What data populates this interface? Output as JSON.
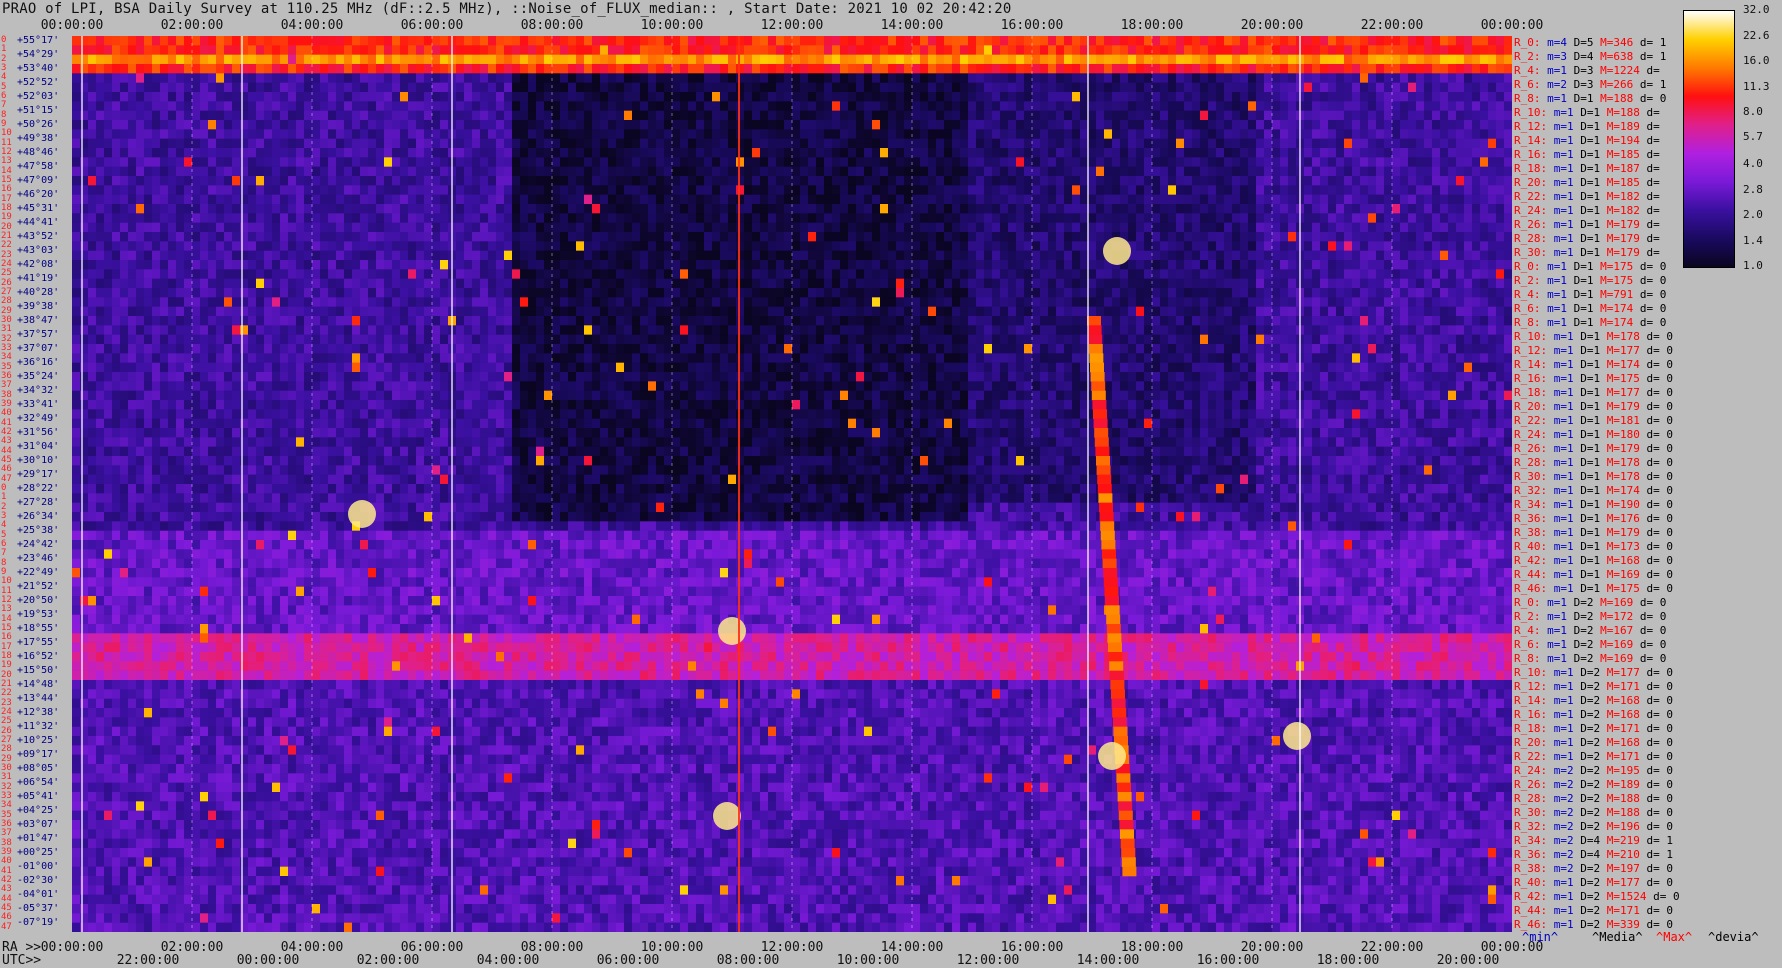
{
  "title": "PRAO of LPI, BSA Daily Survey at 110.25 MHz (dF::2.5 MHz), ::Noise_of_FLUX_median:: , Start Date: 2021 10 02 20:42:20",
  "chart_data": {
    "type": "heatmap",
    "title": "PRAO of LPI, BSA Daily Survey at 110.25 MHz (dF::2.5 MHz), ::Noise_of_FLUX_median:: , Start Date: 2021 10 02 20:42:20",
    "x_top_labels": [
      "00:00:00",
      "02:00:00",
      "04:00:00",
      "06:00:00",
      "08:00:00",
      "10:00:00",
      "12:00:00",
      "14:00:00",
      "16:00:00",
      "18:00:00",
      "20:00:00",
      "22:00:00",
      "00:00:00"
    ],
    "ra_prefix": "RA >>",
    "ra_labels": [
      "00:00:00",
      "02:00:00",
      "04:00:00",
      "06:00:00",
      "08:00:00",
      "10:00:00",
      "12:00:00",
      "14:00:00",
      "16:00:00",
      "18:00:00",
      "20:00:00",
      "22:00:00",
      "00:00:00"
    ],
    "utc_prefix": "UTC>>",
    "utc_labels": [
      "22:00:00",
      "00:00:00",
      "02:00:00",
      "04:00:00",
      "06:00:00",
      "08:00:00",
      "10:00:00",
      "12:00:00",
      "14:00:00",
      "16:00:00",
      "18:00:00",
      "20:00:00"
    ],
    "row_indices": [
      "0",
      "1",
      "2",
      "3",
      "4",
      "5",
      "6",
      "7",
      "8",
      "9",
      "10",
      "11",
      "12",
      "13",
      "14",
      "15",
      "16",
      "17",
      "18",
      "19",
      "20",
      "21",
      "22",
      "23",
      "24",
      "25",
      "26",
      "27",
      "28",
      "29",
      "30",
      "31",
      "32",
      "33",
      "34",
      "35",
      "36",
      "37",
      "38",
      "39",
      "40",
      "41",
      "42",
      "43",
      "44",
      "45",
      "46",
      "47",
      "0",
      "1",
      "2",
      "3",
      "4",
      "5",
      "6",
      "7",
      "8",
      "9",
      "10",
      "11",
      "12",
      "13",
      "14",
      "15",
      "16",
      "17",
      "18",
      "19",
      "20",
      "21",
      "22",
      "23",
      "24",
      "25",
      "26",
      "27",
      "28",
      "29",
      "30",
      "31",
      "32",
      "33",
      "34",
      "35",
      "36",
      "37",
      "38",
      "39",
      "40",
      "41",
      "42",
      "43",
      "44",
      "45",
      "46",
      "47"
    ],
    "declinations": [
      "+55°17'",
      "+54°29'",
      "+53°40'",
      "+52°52'",
      "+52°03'",
      "+51°15'",
      "+50°26'",
      "+49°38'",
      "+48°46'",
      "+47°58'",
      "+47°09'",
      "+46°20'",
      "+45°31'",
      "+44°41'",
      "+43°52'",
      "+43°03'",
      "+42°08'",
      "+41°19'",
      "+40°28'",
      "+39°38'",
      "+38°47'",
      "+37°57'",
      "+37°07'",
      "+36°16'",
      "+35°24'",
      "+34°32'",
      "+33°41'",
      "+32°49'",
      "+31°56'",
      "+31°04'",
      "+30°10'",
      "+29°17'",
      "+28°22'",
      "+27°28'",
      "+26°34'",
      "+25°38'",
      "+24°42'",
      "+23°46'",
      "+22°49'",
      "+21°52'",
      "+20°50'",
      "+19°53'",
      "+18°55'",
      "+17°55'",
      "+16°52'",
      "+15°50'",
      "+14°48'",
      "+13°44'",
      "+12°38'",
      "+11°32'",
      "+10°25'",
      "+09°17'",
      "+08°05'",
      "+06°54'",
      "+05°41'",
      "+04°25'",
      "+03°07'",
      "+01°47'",
      "+00°25'",
      "-01°00'",
      "-02°30'",
      "-04°01'",
      "-05°37'",
      "-07°19'"
    ],
    "row_stats": [
      [
        "R_0:",
        "m=4",
        "D=5",
        "M=346",
        "d= 1"
      ],
      [
        "R_2:",
        "m=3",
        "D=4",
        "M=638",
        "d= 1"
      ],
      [
        "R_4:",
        "m=1",
        "D=3",
        "M=1224",
        "d="
      ],
      [
        "R_6:",
        "m=2",
        "D=3",
        "M=266",
        "d= 1"
      ],
      [
        "R_8:",
        "m=1",
        "D=1",
        "M=188",
        "d= 0"
      ],
      [
        "R_10:",
        "m=1",
        "D=1",
        "M=188",
        "d="
      ],
      [
        "R_12:",
        "m=1",
        "D=1",
        "M=189",
        "d="
      ],
      [
        "R_14:",
        "m=1",
        "D=1",
        "M=194",
        "d="
      ],
      [
        "R_16:",
        "m=1",
        "D=1",
        "M=185",
        "d="
      ],
      [
        "R_18:",
        "m=1",
        "D=1",
        "M=187",
        "d="
      ],
      [
        "R_20:",
        "m=1",
        "D=1",
        "M=185",
        "d="
      ],
      [
        "R_22:",
        "m=1",
        "D=1",
        "M=182",
        "d="
      ],
      [
        "R_24:",
        "m=1",
        "D=1",
        "M=182",
        "d="
      ],
      [
        "R_26:",
        "m=1",
        "D=1",
        "M=179",
        "d="
      ],
      [
        "R_28:",
        "m=1",
        "D=1",
        "M=179",
        "d="
      ],
      [
        "R_30:",
        "m=1",
        "D=1",
        "M=179",
        "d="
      ],
      [
        "R_0:",
        "m=1",
        "D=1",
        "M=175",
        "d= 0"
      ],
      [
        "R_2:",
        "m=1",
        "D=1",
        "M=175",
        "d= 0"
      ],
      [
        "R_4:",
        "m=1",
        "D=1",
        "M=791",
        "d= 0"
      ],
      [
        "R_6:",
        "m=1",
        "D=1",
        "M=174",
        "d= 0"
      ],
      [
        "R_8:",
        "m=1",
        "D=1",
        "M=174",
        "d= 0"
      ],
      [
        "R_10:",
        "m=1",
        "D=1",
        "M=178",
        "d= 0"
      ],
      [
        "R_12:",
        "m=1",
        "D=1",
        "M=177",
        "d= 0"
      ],
      [
        "R_14:",
        "m=1",
        "D=1",
        "M=174",
        "d= 0"
      ],
      [
        "R_16:",
        "m=1",
        "D=1",
        "M=175",
        "d= 0"
      ],
      [
        "R_18:",
        "m=1",
        "D=1",
        "M=177",
        "d= 0"
      ],
      [
        "R_20:",
        "m=1",
        "D=1",
        "M=179",
        "d= 0"
      ],
      [
        "R_22:",
        "m=1",
        "D=1",
        "M=181",
        "d= 0"
      ],
      [
        "R_24:",
        "m=1",
        "D=1",
        "M=180",
        "d= 0"
      ],
      [
        "R_26:",
        "m=1",
        "D=1",
        "M=179",
        "d= 0"
      ],
      [
        "R_28:",
        "m=1",
        "D=1",
        "M=178",
        "d= 0"
      ],
      [
        "R_30:",
        "m=1",
        "D=1",
        "M=178",
        "d= 0"
      ],
      [
        "R_32:",
        "m=1",
        "D=1",
        "M=174",
        "d= 0"
      ],
      [
        "R_34:",
        "m=1",
        "D=1",
        "M=190",
        "d= 0"
      ],
      [
        "R_36:",
        "m=1",
        "D=1",
        "M=176",
        "d= 0"
      ],
      [
        "R_38:",
        "m=1",
        "D=1",
        "M=179",
        "d= 0"
      ],
      [
        "R_40:",
        "m=1",
        "D=1",
        "M=173",
        "d= 0"
      ],
      [
        "R_42:",
        "m=1",
        "D=1",
        "M=168",
        "d= 0"
      ],
      [
        "R_44:",
        "m=1",
        "D=1",
        "M=169",
        "d= 0"
      ],
      [
        "R_46:",
        "m=1",
        "D=1",
        "M=175",
        "d= 0"
      ],
      [
        "R_0:",
        "m=1",
        "D=2",
        "M=169",
        "d= 0"
      ],
      [
        "R_2:",
        "m=1",
        "D=2",
        "M=172",
        "d= 0"
      ],
      [
        "R_4:",
        "m=1",
        "D=2",
        "M=167",
        "d= 0"
      ],
      [
        "R_6:",
        "m=1",
        "D=2",
        "M=169",
        "d= 0"
      ],
      [
        "R_8:",
        "m=1",
        "D=2",
        "M=169",
        "d= 0"
      ],
      [
        "R_10:",
        "m=1",
        "D=2",
        "M=177",
        "d= 0"
      ],
      [
        "R_12:",
        "m=1",
        "D=2",
        "M=171",
        "d= 0"
      ],
      [
        "R_14:",
        "m=1",
        "D=2",
        "M=168",
        "d= 0"
      ],
      [
        "R_16:",
        "m=1",
        "D=2",
        "M=168",
        "d= 0"
      ],
      [
        "R_18:",
        "m=1",
        "D=2",
        "M=171",
        "d= 0"
      ],
      [
        "R_20:",
        "m=1",
        "D=2",
        "M=168",
        "d= 0"
      ],
      [
        "R_22:",
        "m=1",
        "D=2",
        "M=171",
        "d= 0"
      ],
      [
        "R_24:",
        "m=2",
        "D=2",
        "M=195",
        "d= 0"
      ],
      [
        "R_26:",
        "m=2",
        "D=2",
        "M=189",
        "d= 0"
      ],
      [
        "R_28:",
        "m=2",
        "D=2",
        "M=188",
        "d= 0"
      ],
      [
        "R_30:",
        "m=2",
        "D=2",
        "M=188",
        "d= 0"
      ],
      [
        "R_32:",
        "m=2",
        "D=2",
        "M=196",
        "d= 0"
      ],
      [
        "R_34:",
        "m=2",
        "D=4",
        "M=219",
        "d= 1"
      ],
      [
        "R_36:",
        "m=2",
        "D=4",
        "M=210",
        "d= 1"
      ],
      [
        "R_38:",
        "m=2",
        "D=2",
        "M=197",
        "d= 0"
      ],
      [
        "R_40:",
        "m=1",
        "D=2",
        "M=177",
        "d= 0"
      ],
      [
        "R_42:",
        "m=1",
        "D=2",
        "M=1524",
        "d= 0"
      ],
      [
        "R_44:",
        "m=1",
        "D=2",
        "M=171",
        "d= 0"
      ],
      [
        "R_46:",
        "m=1",
        "D=2",
        "M=339",
        "d= 0"
      ]
    ],
    "colorbar_ticks": [
      "32.0",
      "22.6",
      "16.0",
      "11.3",
      "8.0",
      "5.7",
      "4.0",
      "2.8",
      "2.0",
      "1.4",
      "1.0"
    ],
    "colorbar_range": [
      1.0,
      32.0
    ],
    "colorbar_scale": "log",
    "legend": [
      "^min^",
      "^Media^",
      "^Max^",
      "^devia^"
    ],
    "legend_colors": [
      "#0000c0",
      "#000000",
      "#ff0000",
      "#000000"
    ],
    "colormap": [
      "#0a0520",
      "#1a0a60",
      "#3a10a0",
      "#7a1ad8",
      "#b020e0",
      "#e0208a",
      "#ff1010",
      "#ff7a00",
      "#ffd000",
      "#ffffff"
    ]
  }
}
